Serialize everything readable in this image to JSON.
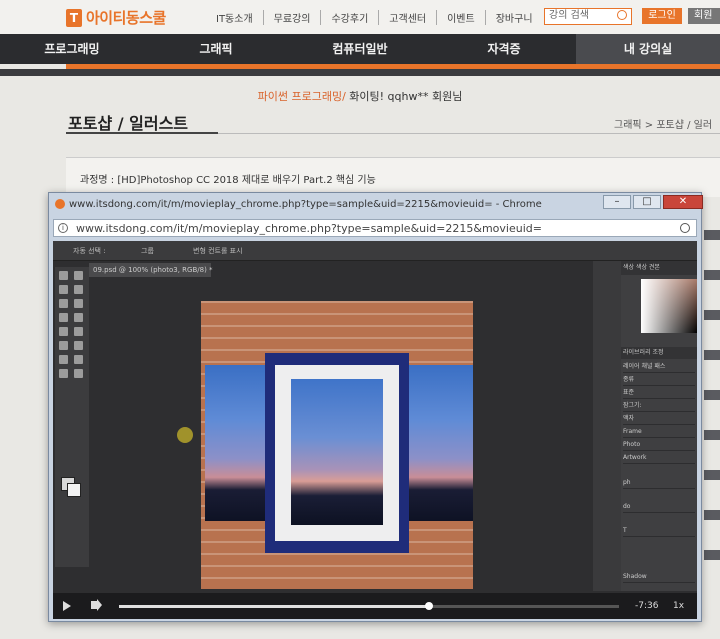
{
  "site": {
    "logo": "아이티동스쿨",
    "top_nav": [
      "IT동소개",
      "무료강의",
      "수강후기",
      "고객센터",
      "이벤트",
      "장바구니"
    ],
    "search_placeholder": "강의 검색",
    "login": "로그인",
    "signup": "회원"
  },
  "main_nav": [
    "프로그래밍",
    "그래픽",
    "컴퓨터일반",
    "자격증",
    "내 강의실"
  ],
  "greeting": {
    "accent": "파이썬 프로그래밍/",
    "rest": " 화이팅! qqhw** 회원님"
  },
  "page": {
    "title": "포토샵 / 일러스트",
    "breadcrumb": "그래픽 > 포토샵 / 일러",
    "course_label": "과정명 : [HD]Photoshop CC 2018 제대로 배우기 Part.2 핵심 기능"
  },
  "popup": {
    "window_title": "www.itsdong.com/it/m/movieplay_chrome.php?type=sample&uid=2215&movieuid= - Chrome",
    "url": "www.itsdong.com/it/m/movieplay_chrome.php?type=sample&uid=2215&movieuid=",
    "photoshop": {
      "options": [
        "자동 선택 :",
        "그룹",
        "변형 컨트롤 표시"
      ],
      "doc_tab": "09.psd @ 100% (photo3, RGB/8) *",
      "panel_tabs": "색상  색상 견본",
      "layer_tabs": "라이브러리  조정",
      "layers": [
        "레이어  채널  패스",
        "종류",
        "표준",
        "잠그기:",
        "액자",
        "Frame",
        "Photo",
        "Artwork",
        "ph",
        "do",
        "T",
        "Shadow"
      ]
    },
    "player": {
      "time": "-7:36",
      "speed": "1x",
      "progress": 0.62
    }
  }
}
